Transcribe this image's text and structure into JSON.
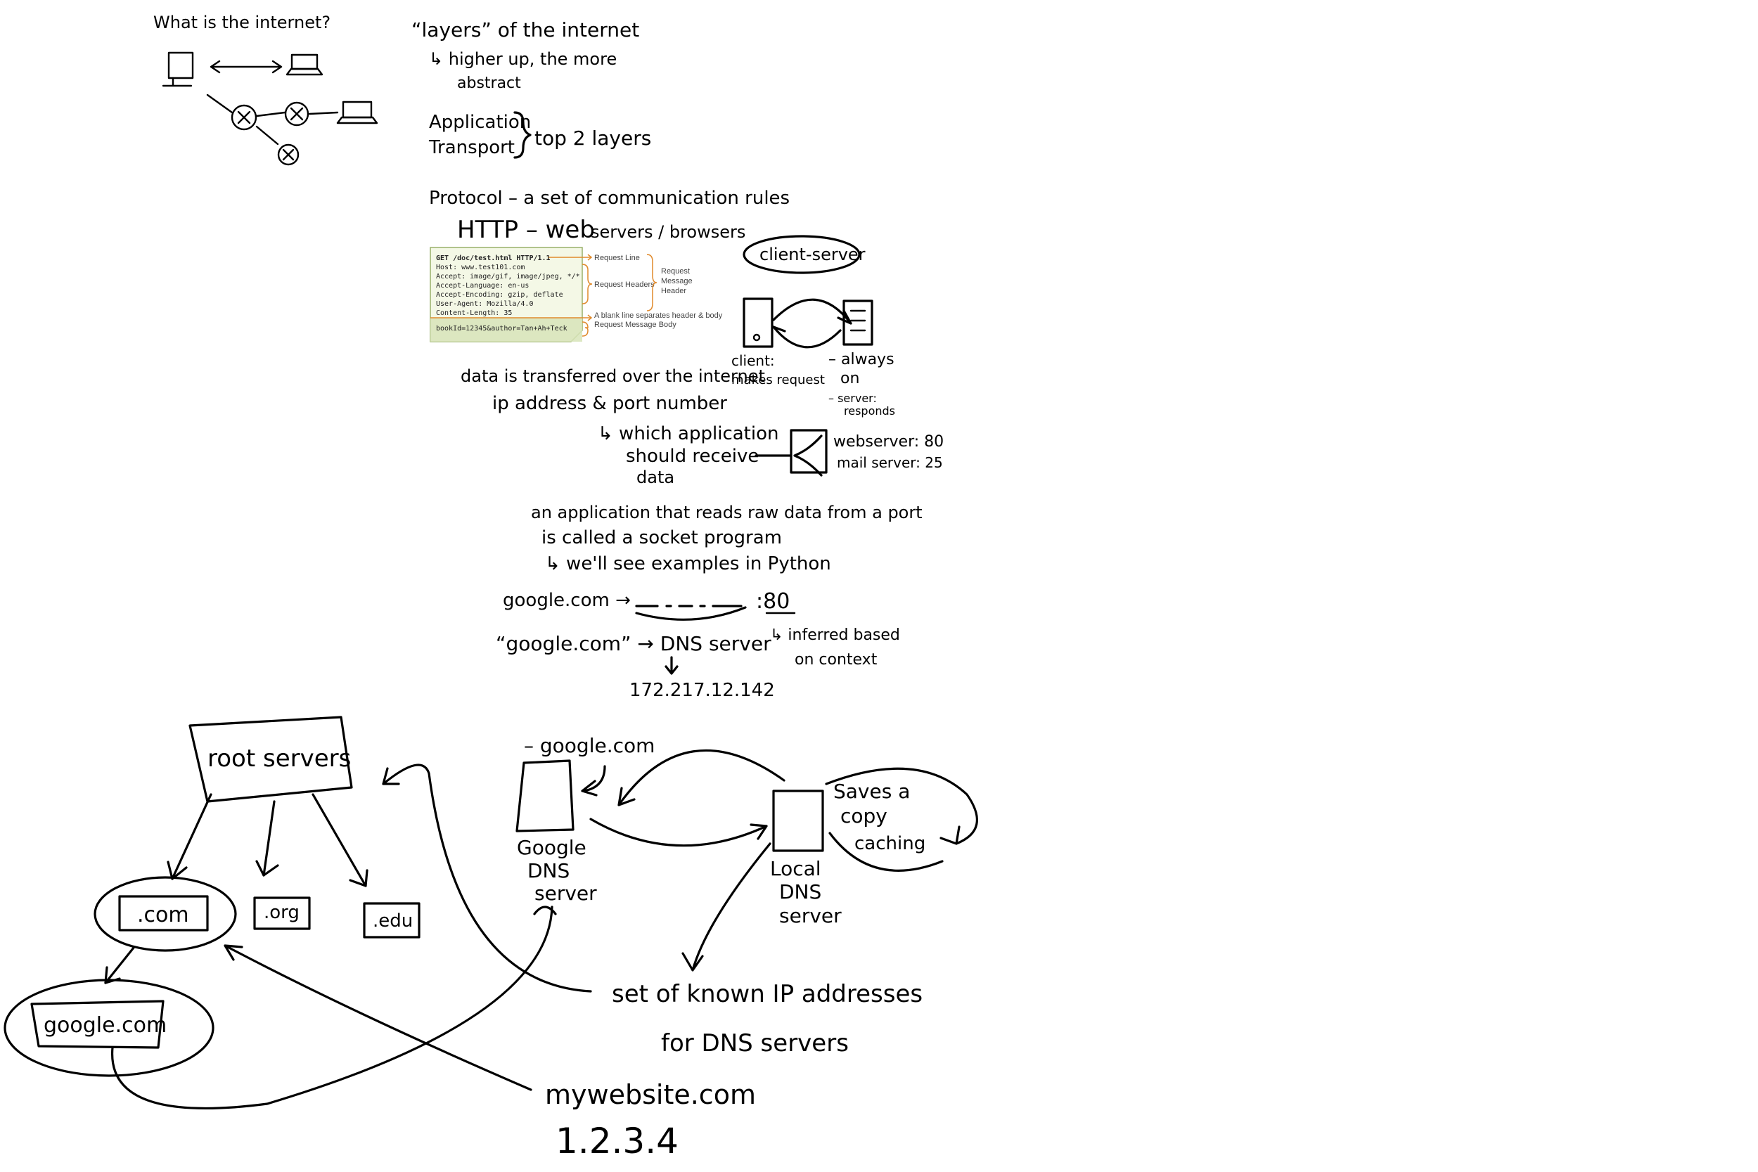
{
  "notes": {
    "title": "What is the internet?",
    "layers": {
      "heading": "“layers” of the internet",
      "sub1": "↳ higher up, the more",
      "sub2": "abstract",
      "app": "Application",
      "transport": "Transport",
      "top2": "top 2 layers"
    },
    "protocol": {
      "def": "Protocol – a set of communication rules",
      "http": "HTTP – web",
      "servers": "servers / browsers"
    },
    "http_request": {
      "lines": [
        "GET /doc/test.html HTTP/1.1",
        "Host: www.test101.com",
        "Accept: image/gif, image/jpeg, */*",
        "Accept-Language: en-us",
        "Accept-Encoding: gzip, deflate",
        "User-Agent: Mozilla/4.0",
        "Content-Length: 35"
      ],
      "body": "bookId=12345&author=Tan+Ah+Teck",
      "label_request_line": "Request Line",
      "label_request_headers": "Request Headers",
      "label_message_header_1": "Request",
      "label_message_header_2": "Message",
      "label_message_header_3": "Header",
      "label_blank_line": "A blank line separates header & body",
      "label_message_body": "Request Message Body"
    },
    "client_server": {
      "bubble": "client-server",
      "client1": "client:",
      "client2": "makes request",
      "always1": "– always",
      "always2": "on",
      "server1": "– server:",
      "server2": "responds"
    },
    "data": {
      "line1": "data is transferred over the internet",
      "line2": "ip address & port number",
      "which1": "↳ which application",
      "which2": "should receive",
      "which3": "data",
      "webserver": "webserver: 80",
      "mailserver": "mail server: 25"
    },
    "socket": {
      "line1": "an application that reads raw data from a port",
      "line2": "is called a socket program",
      "line3": "↳ we'll see examples in Python"
    },
    "dns": {
      "google_arrow": "google.com →",
      "port": ":80",
      "inferred1": "↳ inferred based",
      "inferred2": "on context",
      "quoted": "“google.com” → DNS server",
      "ip": "172.217.12.142"
    },
    "tree": {
      "root": "root servers",
      "com": ".com",
      "org": ".org",
      "edu": ".edu",
      "googlecom": "google.com"
    },
    "resolution": {
      "google_dot": "– google.com",
      "google_dns1": "Google",
      "google_dns2": "DNS",
      "google_dns3": "server",
      "local1": "Local",
      "local2": "DNS",
      "local3": "server",
      "saves1": "Saves a",
      "saves2": "copy",
      "saves3": "caching",
      "known1": "set of known IP addresses",
      "known2": "for DNS servers",
      "mywebsite": "mywebsite.com",
      "myip": "1.2.3.4"
    }
  }
}
